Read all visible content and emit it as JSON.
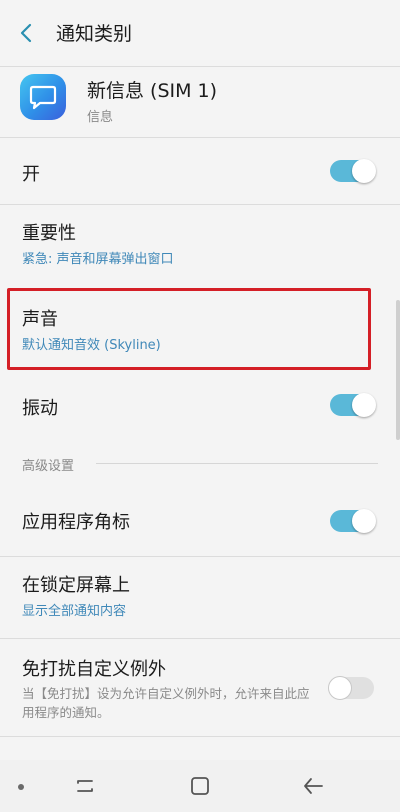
{
  "header": {
    "title": "通知类别",
    "back_icon": "chevron-left-icon"
  },
  "app": {
    "name": "新信息 (SIM 1)",
    "subtitle": "信息",
    "icon": "message-bubble-icon",
    "icon_color": "#2f8fe8"
  },
  "settings": {
    "open": {
      "label": "开",
      "enabled": true
    },
    "importance": {
      "label": "重要性",
      "value": "紧急: 声音和屏幕弹出窗口"
    },
    "sound": {
      "label": "声音",
      "value": "默认通知音效 (Skyline)",
      "highlighted": true
    },
    "vibration": {
      "label": "振动",
      "enabled": true
    },
    "advanced_label": "高级设置",
    "badge": {
      "label": "应用程序角标",
      "enabled": true
    },
    "lock_screen": {
      "label": "在锁定屏幕上",
      "value": "显示全部通知内容"
    },
    "dnd_exception": {
      "label": "免打扰自定义例外",
      "description": "当【免打扰】设为允许自定义例外时，允许来自此应用程序的通知。",
      "enabled": false
    }
  },
  "navbar": {
    "items": [
      "dot-icon",
      "recents-icon",
      "home-icon",
      "back-icon"
    ]
  },
  "colors": {
    "accent": "#5ab8d8",
    "link": "#3f88b8",
    "highlight_border": "#d41f26"
  }
}
